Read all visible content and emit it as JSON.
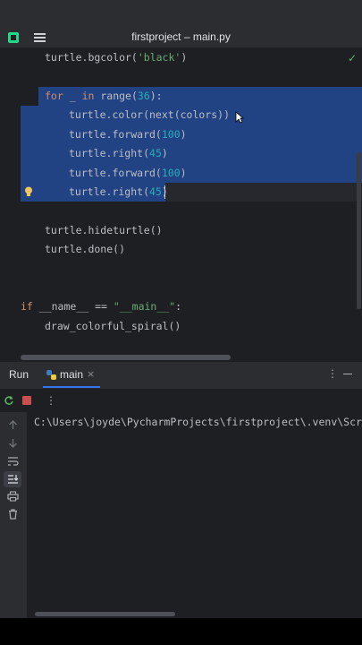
{
  "window": {
    "title": "firstproject – main.py"
  },
  "editor": {
    "lines": {
      "bgcolor": "turtle.bgcolor(",
      "bgcolor_arg": "'black'",
      "bgcolor_close": ")",
      "for_kw": "for",
      "for_var": " _ ",
      "in_kw": "in",
      "range_call": " range(",
      "range_num": "36",
      "range_close": "):",
      "color_line": "turtle.color(next(colors))",
      "forward_1": "turtle.forward(",
      "forward_1_num": "100",
      "paren_close": ")",
      "right_1": "turtle.right(",
      "right_1_num": "45",
      "forward_2": "turtle.forward(",
      "forward_2_num": "100",
      "right_2": "turtle.right(",
      "right_2_num": "45",
      "hideturtle": "turtle.hideturtle()",
      "done": "turtle.done()",
      "if_kw": "if",
      "main_cond_a": " __name__ == ",
      "main_str": "\"__main__\"",
      "main_cond_b": ":",
      "call_main": "draw_colorful_spiral()"
    }
  },
  "run_panel": {
    "label": "Run",
    "tab": "main",
    "output_line": "C:\\Users\\joyde\\PycharmProjects\\firstproject\\.venv\\Scrip"
  },
  "colors": {
    "keyword": "#cf8e6d",
    "number": "#2aacb8",
    "string": "#6aab73",
    "selection": "#214283",
    "accent": "#3574f0"
  },
  "icons": [
    "pycharm-logo-icon",
    "hamburger-menu-icon",
    "check-icon",
    "bulb-icon",
    "python-icon",
    "rerun-icon",
    "stop-icon",
    "kebab-icon",
    "up-arrow-icon",
    "down-arrow-icon",
    "soft-wrap-icon",
    "scroll-to-end-icon",
    "print-icon",
    "trash-icon"
  ]
}
